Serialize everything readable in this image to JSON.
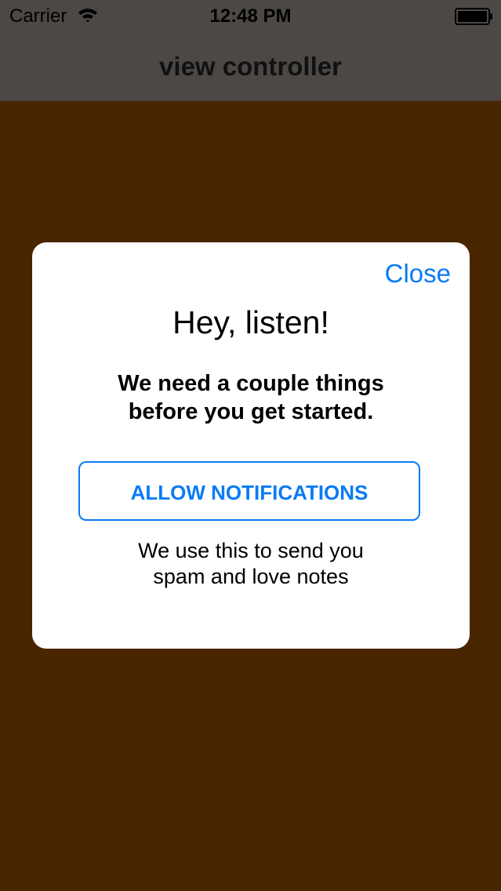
{
  "status_bar": {
    "carrier": "Carrier",
    "time": "12:48 PM",
    "wifi_icon": "wifi-icon",
    "battery_icon": "battery-full-icon"
  },
  "nav": {
    "title": "view controller"
  },
  "dialog": {
    "close_label": "Close",
    "title": "Hey, listen!",
    "subtitle_line1": "We need a couple things",
    "subtitle_line2": "before you get started.",
    "allow_button_label": "ALLOW NOTIFICATIONS",
    "explainer_line1": "We use this to send you",
    "explainer_line2": "spam and love notes"
  },
  "colors": {
    "background": "#4a2600",
    "nav_bar": "#4b4845",
    "accent": "#0a7bf5",
    "dialog": "#ffffff"
  }
}
